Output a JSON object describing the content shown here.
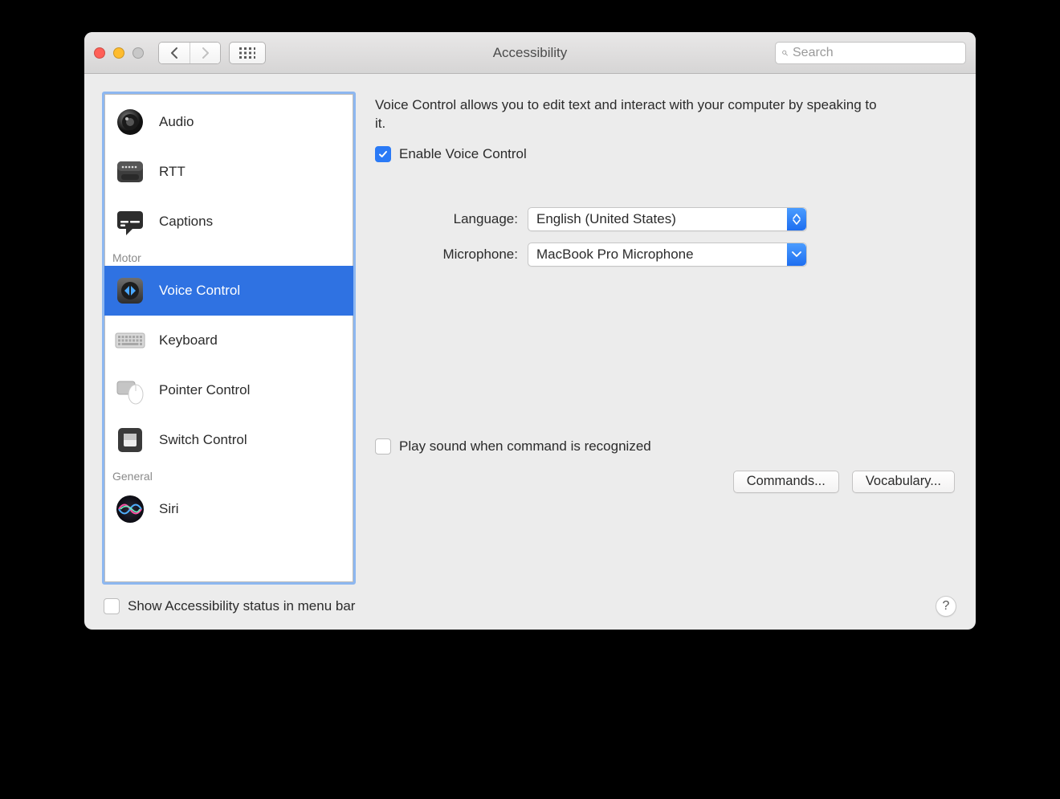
{
  "window": {
    "title": "Accessibility"
  },
  "search": {
    "placeholder": "Search"
  },
  "sidebar": {
    "sections": [
      {
        "label": "",
        "items": [
          {
            "id": "audio",
            "label": "Audio"
          },
          {
            "id": "rtt",
            "label": "RTT"
          },
          {
            "id": "captions",
            "label": "Captions"
          }
        ]
      },
      {
        "label": "Motor",
        "items": [
          {
            "id": "voice-control",
            "label": "Voice Control",
            "selected": true
          },
          {
            "id": "keyboard",
            "label": "Keyboard"
          },
          {
            "id": "pointer-control",
            "label": "Pointer Control"
          },
          {
            "id": "switch-control",
            "label": "Switch Control"
          }
        ]
      },
      {
        "label": "General",
        "items": [
          {
            "id": "siri",
            "label": "Siri"
          }
        ]
      }
    ]
  },
  "content": {
    "description": "Voice Control allows you to edit text and interact with your computer by speaking to it.",
    "enable_label": "Enable Voice Control",
    "enable_checked": true,
    "language_label": "Language:",
    "language_value": "English (United States)",
    "microphone_label": "Microphone:",
    "microphone_value": "MacBook Pro Microphone",
    "play_sound_label": "Play sound when command is recognized",
    "play_sound_checked": false,
    "commands_button": "Commands...",
    "vocabulary_button": "Vocabulary..."
  },
  "footer": {
    "show_status_label": "Show Accessibility status in menu bar",
    "show_status_checked": false,
    "help": "?"
  }
}
